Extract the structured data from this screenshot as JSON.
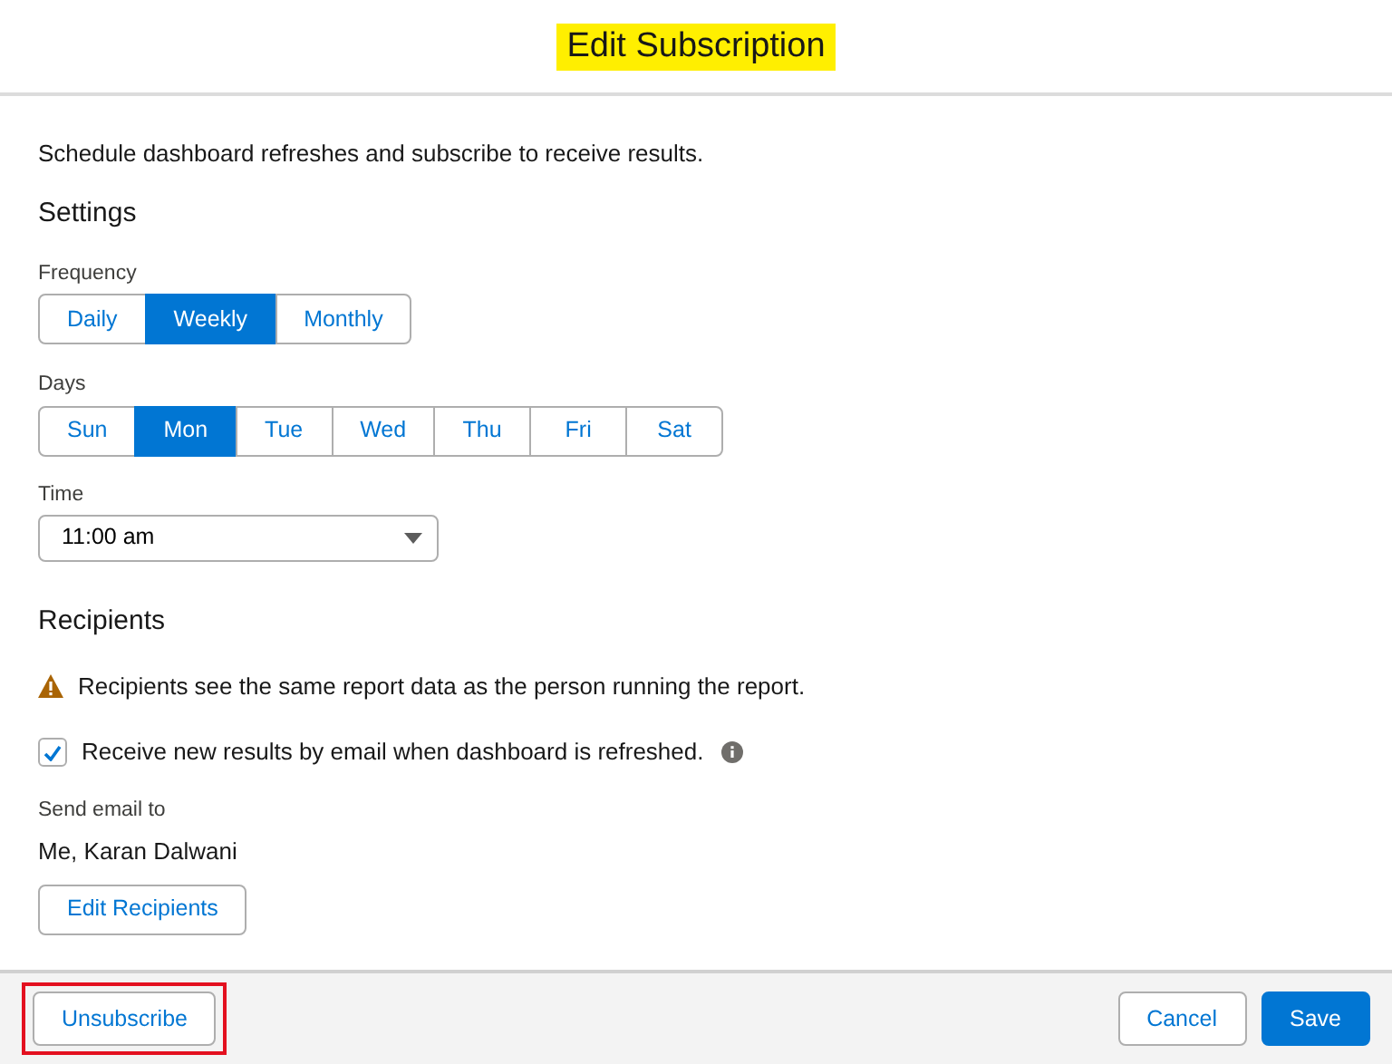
{
  "header": {
    "title": "Edit Subscription",
    "highlighted": true
  },
  "description": "Schedule dashboard refreshes and subscribe to receive results.",
  "settings": {
    "heading": "Settings",
    "frequency": {
      "label": "Frequency",
      "options": [
        {
          "label": "Daily",
          "selected": false
        },
        {
          "label": "Weekly",
          "selected": true
        },
        {
          "label": "Monthly",
          "selected": false
        }
      ]
    },
    "days": {
      "label": "Days",
      "options": [
        {
          "label": "Sun",
          "selected": false
        },
        {
          "label": "Mon",
          "selected": true
        },
        {
          "label": "Tue",
          "selected": false
        },
        {
          "label": "Wed",
          "selected": false
        },
        {
          "label": "Thu",
          "selected": false
        },
        {
          "label": "Fri",
          "selected": false
        },
        {
          "label": "Sat",
          "selected": false
        }
      ]
    },
    "time": {
      "label": "Time",
      "value": "11:00 am"
    }
  },
  "recipients": {
    "heading": "Recipients",
    "warning": "Recipients see the same report data as the person running the report.",
    "receive_email": {
      "label": "Receive new results by email when dashboard is refreshed.",
      "checked": true
    },
    "send_to_label": "Send email to",
    "send_to": "Me, Karan Dalwani",
    "edit_button": "Edit Recipients"
  },
  "footer": {
    "unsubscribe": {
      "label": "Unsubscribe",
      "outlined": true
    },
    "cancel": "Cancel",
    "save": "Save"
  }
}
